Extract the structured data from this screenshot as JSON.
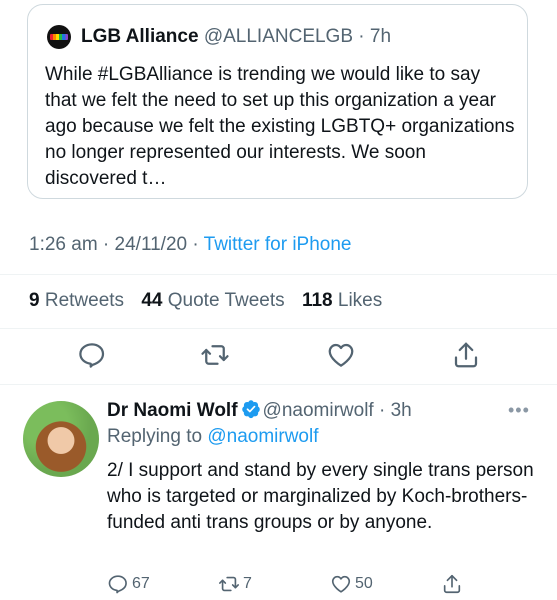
{
  "quoted": {
    "name": "LGB Alliance",
    "handle": "@ALLIANCELGB",
    "time": "7h",
    "text": "While #LGBAlliance is trending we would like to say that we felt the need to set up this organization a year ago because we felt the existing LGBTQ+ organizations no longer represented our interests. We soon discovered t…"
  },
  "meta": {
    "time": "1:26 am",
    "date": "24/11/20",
    "source": "Twitter for iPhone"
  },
  "stats": {
    "retweets_count": "9",
    "retweets_label": "Retweets",
    "quote_count": "44",
    "quote_label": "Quote Tweets",
    "likes_count": "118",
    "likes_label": "Likes"
  },
  "actions": {
    "icons": [
      "reply-icon",
      "retweet-icon",
      "like-icon",
      "share-icon"
    ]
  },
  "reply": {
    "name": "Dr Naomi Wolf",
    "handle": "@naomirwolf",
    "time": "3h",
    "replying_prefix": "Replying to",
    "replying_to": "@naomirwolf",
    "text": "2/ I support and stand by every single trans person who is targeted or marginalized by Koch-brothers-funded anti trans groups or by anyone.",
    "reply_count": "67",
    "retweet_count": "7",
    "like_count": "50"
  },
  "colors": {
    "accent": "#1d9bf0",
    "secondary_text": "#536471",
    "verified": "#1d9bf0"
  }
}
